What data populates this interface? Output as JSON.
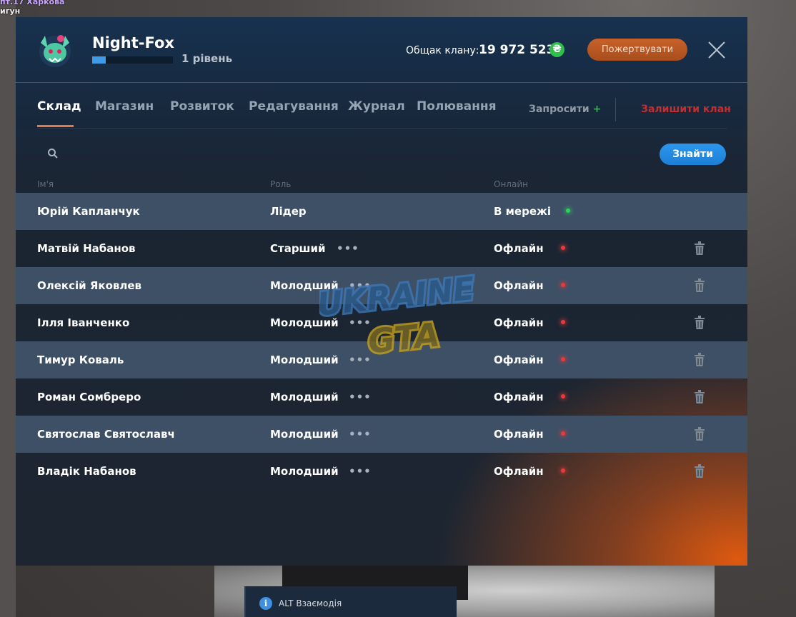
{
  "background": {
    "top_text_line1": "пт.17 Харкова",
    "top_text_line2": "игун"
  },
  "header": {
    "clan_name": "Night-Fox",
    "level": "1 рівень",
    "xp_progress": 0.17,
    "bank_label": "Общак клану:",
    "bank_value": "19 972 523",
    "currency_symbol": "₴",
    "donate_label": "Пожертвувати"
  },
  "tabs": [
    {
      "label": "Склад",
      "active": true
    },
    {
      "label": "Магазин",
      "active": false
    },
    {
      "label": "Розвиток",
      "active": false
    },
    {
      "label": "Редагування",
      "active": false
    },
    {
      "label": "Журнал",
      "active": false
    },
    {
      "label": "Полювання",
      "active": false
    }
  ],
  "actions": {
    "invite_label": "Запросити",
    "invite_plus": "+",
    "leave_label": "Залишити клан"
  },
  "search": {
    "placeholder": "",
    "button_label": "Знайти"
  },
  "table": {
    "headers": {
      "name": "Ім'я",
      "role": "Роль",
      "online": "Онлайн"
    },
    "rows": [
      {
        "name": "Юрій Капланчук",
        "role": "Лідер",
        "status": "В мережі",
        "online": true,
        "menu": false,
        "delete": false
      },
      {
        "name": "Матвій Набанов",
        "role": "Старший",
        "status": "Офлайн",
        "online": false,
        "menu": true,
        "delete": true
      },
      {
        "name": "Олексій Яковлев",
        "role": "Молодший",
        "status": "Офлайн",
        "online": false,
        "menu": true,
        "delete": true
      },
      {
        "name": "Ілля Іванченко",
        "role": "Молодший",
        "status": "Офлайн",
        "online": false,
        "menu": true,
        "delete": true
      },
      {
        "name": "Тимур Коваль",
        "role": "Молодший",
        "status": "Офлайн",
        "online": false,
        "menu": true,
        "delete": true
      },
      {
        "name": "Роман Сомбреро",
        "role": "Молодший",
        "status": "Офлайн",
        "online": false,
        "menu": true,
        "delete": true
      },
      {
        "name": "Святослав Святославч",
        "role": "Молодший",
        "status": "Офлайн",
        "online": false,
        "menu": true,
        "delete": true
      },
      {
        "name": "Владік Набанов",
        "role": "Молодший",
        "status": "Офлайн",
        "online": false,
        "menu": true,
        "delete": true
      }
    ],
    "menu_glyph": "•••"
  },
  "watermark": {
    "line1": "UKRAINE",
    "line2": "GTA"
  },
  "hint": {
    "icon": "i",
    "text": "ALT Взаємодія"
  },
  "colors": {
    "accent_orange": "#e37746",
    "online_green": "#2fd15a",
    "offline_red": "#e83a3a",
    "leave_red": "#c32e30",
    "find_blue": "#1d7fd6"
  }
}
